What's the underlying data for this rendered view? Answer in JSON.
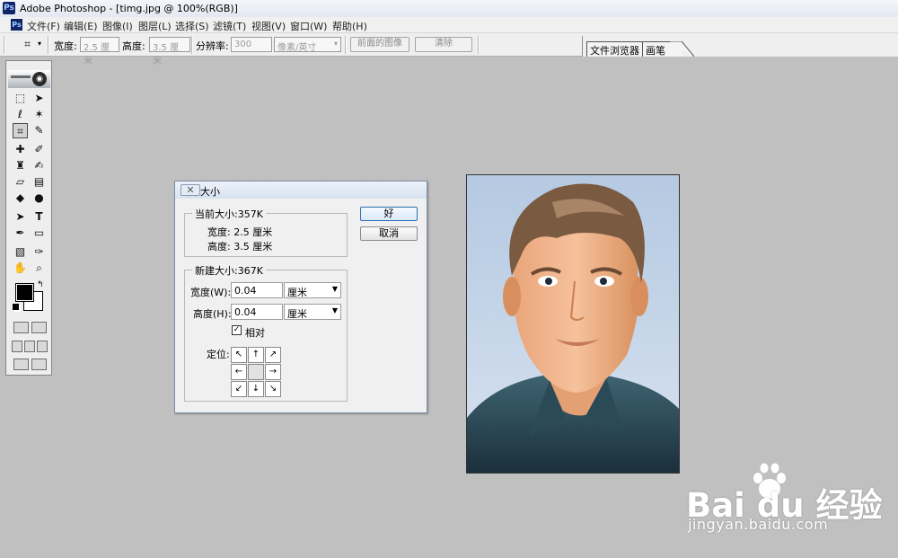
{
  "window": {
    "title": "Adobe Photoshop - [timg.jpg @ 100%(RGB)]"
  },
  "menu": [
    "文件(F)",
    "编辑(E)",
    "图像(I)",
    "图层(L)",
    "选择(S)",
    "滤镜(T)",
    "视图(V)",
    "窗口(W)",
    "帮助(H)"
  ],
  "options": {
    "width_label": "宽度:",
    "width_value": "2.5 厘米",
    "height_label": "高度:",
    "height_value": "3.5 厘米",
    "resolution_label": "分辨率:",
    "resolution_value": "300",
    "unit_value": "像素/英寸",
    "front_image_button": "前面的图像",
    "clear_button": "清除"
  },
  "palette_well": {
    "tabs": [
      "文件浏览器",
      "画笔"
    ]
  },
  "dialog": {
    "title": "画布大小",
    "ok_label": "好",
    "cancel_label": "取消",
    "current": {
      "label": "当前大小:357K",
      "width": "宽度: 2.5 厘米",
      "height": "高度: 3.5 厘米"
    },
    "new": {
      "label": "新建大小:367K",
      "width_label": "宽度(W):",
      "width_value": "0.04",
      "width_unit": "厘米",
      "height_label": "高度(H):",
      "height_value": "0.04",
      "height_unit": "厘米",
      "relative_label": "相对",
      "relative_checked": true,
      "anchor_label": "定位:"
    }
  },
  "watermark": {
    "brand": "Bai du 经验",
    "url": "jingyan.baidu.com"
  },
  "colors": {
    "foreground": "#000000",
    "background": "#ffffff",
    "accent": "#2c6fb6"
  }
}
